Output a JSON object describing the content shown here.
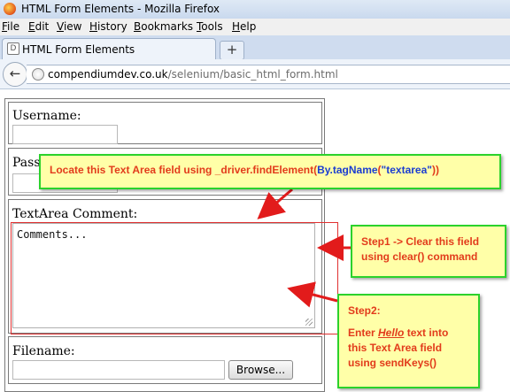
{
  "window": {
    "title": "HTML Form Elements - Mozilla Firefox"
  },
  "menu": {
    "items": [
      "File",
      "Edit",
      "View",
      "History",
      "Bookmarks",
      "Tools",
      "Help"
    ]
  },
  "tabs": {
    "active_label": "HTML Form Elements",
    "new_tab_symbol": "+"
  },
  "address_bar": {
    "host": "compendiumdev.co.uk",
    "path": "/selenium/basic_html_form.html"
  },
  "form": {
    "username_label": "Username:",
    "password_label": "Passw",
    "textarea_label": "TextArea Comment:",
    "textarea_value": "Comments...",
    "filename_label": "Filename:",
    "browse_label": "Browse..."
  },
  "annotations": {
    "locate_prefix": "Locate this Text Area field using _driver.findElement(",
    "locate_code": "By.tagName",
    "locate_paren_open": "(",
    "locate_quote": "\"textarea\"",
    "locate_suffix": "))",
    "step1_line1": "Step1 -> Clear this field",
    "step1_line2": "using clear() command",
    "step2_title": "Step2:",
    "step2_pre": "Enter ",
    "step2_em": "Hello",
    "step2_post": " text into",
    "step2_line2": "this Text Area field",
    "step2_line3": "using sendKeys()"
  },
  "colors": {
    "callout_bg": "#ffffa8",
    "callout_border": "#2bd22b",
    "callout_text": "#e23b1b",
    "arrow": "#e21b1b",
    "highlight_box": "#e03030"
  }
}
